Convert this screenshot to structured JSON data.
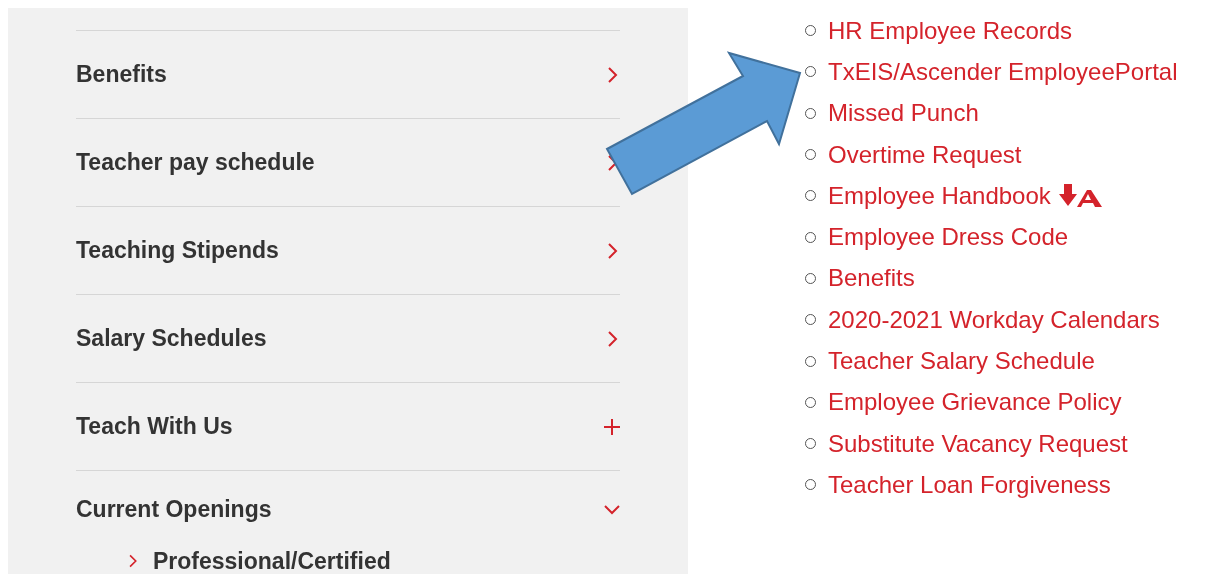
{
  "menu": [
    {
      "label": "Benefits",
      "kind": "link"
    },
    {
      "label": "Teacher pay schedule",
      "kind": "link"
    },
    {
      "label": "Teaching Stipends",
      "kind": "link"
    },
    {
      "label": "Salary Schedules",
      "kind": "link"
    },
    {
      "label": "Teach With Us",
      "kind": "accordion",
      "expanded": false
    },
    {
      "label": "Current Openings",
      "kind": "accordion",
      "expanded": true,
      "children": [
        {
          "label": "Professional/Certified"
        }
      ]
    }
  ],
  "links": [
    {
      "label": "HR Employee Records"
    },
    {
      "label": "TxEIS/Ascender EmployeePortal"
    },
    {
      "label": "Missed Punch"
    },
    {
      "label": "Overtime Request"
    },
    {
      "label": "Employee Handbook",
      "attachment": true
    },
    {
      "label": "Employee Dress Code"
    },
    {
      "label": "Benefits"
    },
    {
      "label": "2020-2021 Workday Calendars"
    },
    {
      "label": "Teacher Salary Schedule"
    },
    {
      "label": "Employee Grievance Policy"
    },
    {
      "label": "Substitute Vacancy Request"
    },
    {
      "label": "Teacher Loan Forgiveness"
    }
  ]
}
